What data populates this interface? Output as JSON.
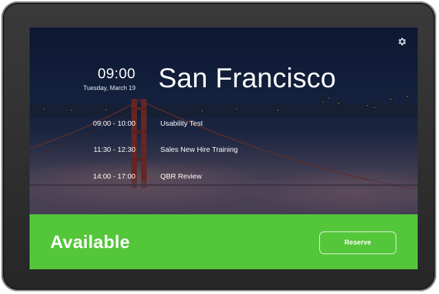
{
  "clock": {
    "time": "09:00",
    "date": "Tuesday, March 19"
  },
  "room": {
    "name": "San Francisco"
  },
  "meetings": [
    {
      "time": "09:00 - 10:00",
      "title": "Usability Test"
    },
    {
      "time": "11:30 - 12:30",
      "title": "Sales New Hire Training"
    },
    {
      "time": "14:00 - 17:00",
      "title": "QBR Review"
    }
  ],
  "status": {
    "label": "Available",
    "reserve_label": "Reserve",
    "color": "#54c63a"
  },
  "icons": {
    "settings": "gear-icon"
  }
}
